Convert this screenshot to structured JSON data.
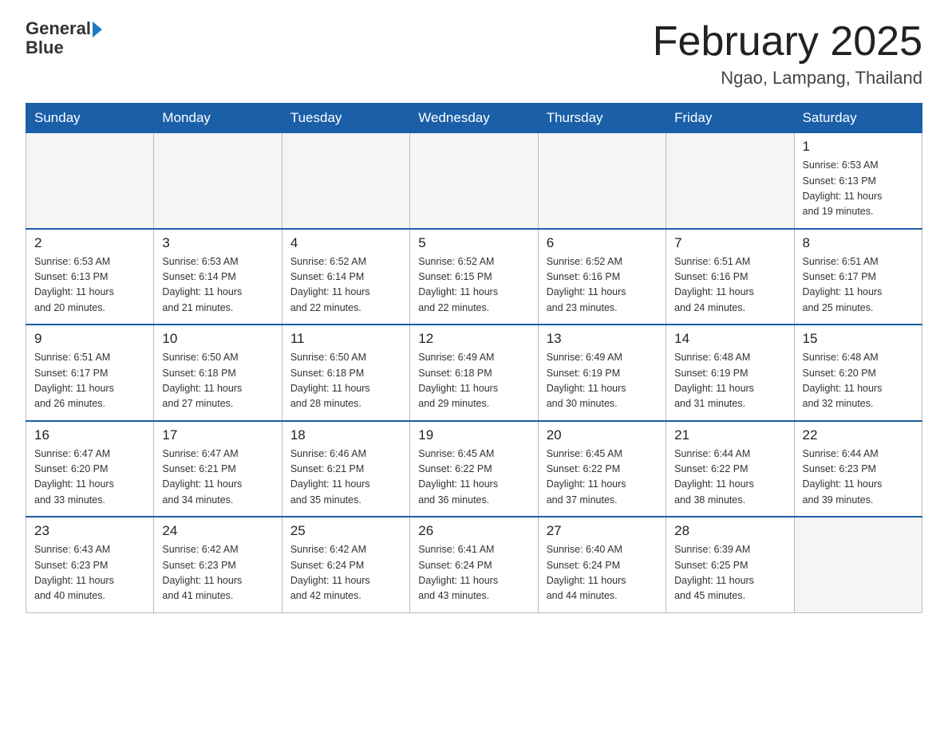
{
  "header": {
    "logo_general": "General",
    "logo_blue": "Blue",
    "month_title": "February 2025",
    "location": "Ngao, Lampang, Thailand"
  },
  "weekdays": [
    "Sunday",
    "Monday",
    "Tuesday",
    "Wednesday",
    "Thursday",
    "Friday",
    "Saturday"
  ],
  "weeks": [
    [
      {
        "day": "",
        "info": ""
      },
      {
        "day": "",
        "info": ""
      },
      {
        "day": "",
        "info": ""
      },
      {
        "day": "",
        "info": ""
      },
      {
        "day": "",
        "info": ""
      },
      {
        "day": "",
        "info": ""
      },
      {
        "day": "1",
        "info": "Sunrise: 6:53 AM\nSunset: 6:13 PM\nDaylight: 11 hours\nand 19 minutes."
      }
    ],
    [
      {
        "day": "2",
        "info": "Sunrise: 6:53 AM\nSunset: 6:13 PM\nDaylight: 11 hours\nand 20 minutes."
      },
      {
        "day": "3",
        "info": "Sunrise: 6:53 AM\nSunset: 6:14 PM\nDaylight: 11 hours\nand 21 minutes."
      },
      {
        "day": "4",
        "info": "Sunrise: 6:52 AM\nSunset: 6:14 PM\nDaylight: 11 hours\nand 22 minutes."
      },
      {
        "day": "5",
        "info": "Sunrise: 6:52 AM\nSunset: 6:15 PM\nDaylight: 11 hours\nand 22 minutes."
      },
      {
        "day": "6",
        "info": "Sunrise: 6:52 AM\nSunset: 6:16 PM\nDaylight: 11 hours\nand 23 minutes."
      },
      {
        "day": "7",
        "info": "Sunrise: 6:51 AM\nSunset: 6:16 PM\nDaylight: 11 hours\nand 24 minutes."
      },
      {
        "day": "8",
        "info": "Sunrise: 6:51 AM\nSunset: 6:17 PM\nDaylight: 11 hours\nand 25 minutes."
      }
    ],
    [
      {
        "day": "9",
        "info": "Sunrise: 6:51 AM\nSunset: 6:17 PM\nDaylight: 11 hours\nand 26 minutes."
      },
      {
        "day": "10",
        "info": "Sunrise: 6:50 AM\nSunset: 6:18 PM\nDaylight: 11 hours\nand 27 minutes."
      },
      {
        "day": "11",
        "info": "Sunrise: 6:50 AM\nSunset: 6:18 PM\nDaylight: 11 hours\nand 28 minutes."
      },
      {
        "day": "12",
        "info": "Sunrise: 6:49 AM\nSunset: 6:18 PM\nDaylight: 11 hours\nand 29 minutes."
      },
      {
        "day": "13",
        "info": "Sunrise: 6:49 AM\nSunset: 6:19 PM\nDaylight: 11 hours\nand 30 minutes."
      },
      {
        "day": "14",
        "info": "Sunrise: 6:48 AM\nSunset: 6:19 PM\nDaylight: 11 hours\nand 31 minutes."
      },
      {
        "day": "15",
        "info": "Sunrise: 6:48 AM\nSunset: 6:20 PM\nDaylight: 11 hours\nand 32 minutes."
      }
    ],
    [
      {
        "day": "16",
        "info": "Sunrise: 6:47 AM\nSunset: 6:20 PM\nDaylight: 11 hours\nand 33 minutes."
      },
      {
        "day": "17",
        "info": "Sunrise: 6:47 AM\nSunset: 6:21 PM\nDaylight: 11 hours\nand 34 minutes."
      },
      {
        "day": "18",
        "info": "Sunrise: 6:46 AM\nSunset: 6:21 PM\nDaylight: 11 hours\nand 35 minutes."
      },
      {
        "day": "19",
        "info": "Sunrise: 6:45 AM\nSunset: 6:22 PM\nDaylight: 11 hours\nand 36 minutes."
      },
      {
        "day": "20",
        "info": "Sunrise: 6:45 AM\nSunset: 6:22 PM\nDaylight: 11 hours\nand 37 minutes."
      },
      {
        "day": "21",
        "info": "Sunrise: 6:44 AM\nSunset: 6:22 PM\nDaylight: 11 hours\nand 38 minutes."
      },
      {
        "day": "22",
        "info": "Sunrise: 6:44 AM\nSunset: 6:23 PM\nDaylight: 11 hours\nand 39 minutes."
      }
    ],
    [
      {
        "day": "23",
        "info": "Sunrise: 6:43 AM\nSunset: 6:23 PM\nDaylight: 11 hours\nand 40 minutes."
      },
      {
        "day": "24",
        "info": "Sunrise: 6:42 AM\nSunset: 6:23 PM\nDaylight: 11 hours\nand 41 minutes."
      },
      {
        "day": "25",
        "info": "Sunrise: 6:42 AM\nSunset: 6:24 PM\nDaylight: 11 hours\nand 42 minutes."
      },
      {
        "day": "26",
        "info": "Sunrise: 6:41 AM\nSunset: 6:24 PM\nDaylight: 11 hours\nand 43 minutes."
      },
      {
        "day": "27",
        "info": "Sunrise: 6:40 AM\nSunset: 6:24 PM\nDaylight: 11 hours\nand 44 minutes."
      },
      {
        "day": "28",
        "info": "Sunrise: 6:39 AM\nSunset: 6:25 PM\nDaylight: 11 hours\nand 45 minutes."
      },
      {
        "day": "",
        "info": ""
      }
    ]
  ]
}
